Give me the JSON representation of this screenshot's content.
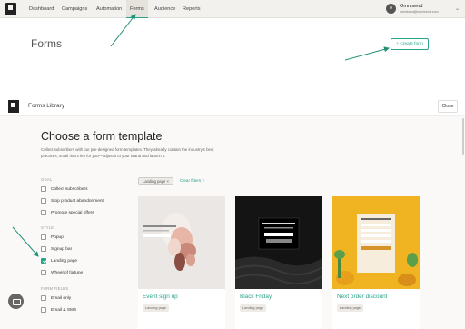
{
  "topnav": {
    "items": [
      {
        "label": "Dashboard",
        "active": false
      },
      {
        "label": "Campaigns",
        "active": false
      },
      {
        "label": "Automation",
        "active": false
      },
      {
        "label": "Forms",
        "active": true
      },
      {
        "label": "Audience",
        "active": false
      },
      {
        "label": "Reports",
        "active": false
      }
    ],
    "account": {
      "avatar": "o",
      "name": "Omnisend",
      "email": "omnisend@omnisend.com"
    }
  },
  "forms_page": {
    "title": "Forms",
    "create_button": "+ Create form"
  },
  "library": {
    "title": "Forms Library",
    "close_button": "Close",
    "heading": "Choose a form template",
    "description": "Collect subscribers with our pre-designed form templates. They already contain the industry's best practices, so all that's left for you—adjust it to your brand and launch it.",
    "filters": {
      "goal": {
        "title": "GOAL",
        "options": [
          {
            "label": "Collect subscribers",
            "checked": false
          },
          {
            "label": "Stop product abandonment",
            "checked": false
          },
          {
            "label": "Promote special offers",
            "checked": false
          }
        ]
      },
      "style": {
        "title": "STYLE",
        "options": [
          {
            "label": "Popup",
            "checked": false
          },
          {
            "label": "Signup bar",
            "checked": false
          },
          {
            "label": "Landing page",
            "checked": true
          },
          {
            "label": "Wheel of fortune",
            "checked": false
          }
        ]
      },
      "form_fields": {
        "title": "FORM FIELDS",
        "options": [
          {
            "label": "Email only",
            "checked": false
          },
          {
            "label": "Email & SMS",
            "checked": false
          }
        ]
      }
    },
    "active_filter": "Landing page ×",
    "clear_filters": "Clear filters ×",
    "templates": [
      {
        "title": "Event sign up",
        "tag": "Landing page"
      },
      {
        "title": "Black Friday",
        "tag": "Landing page"
      },
      {
        "title": "Next order discount",
        "tag": "Landing page"
      }
    ]
  },
  "colors": {
    "accent": "#2aa38a",
    "annotation_arrow": "#1f8f78"
  }
}
